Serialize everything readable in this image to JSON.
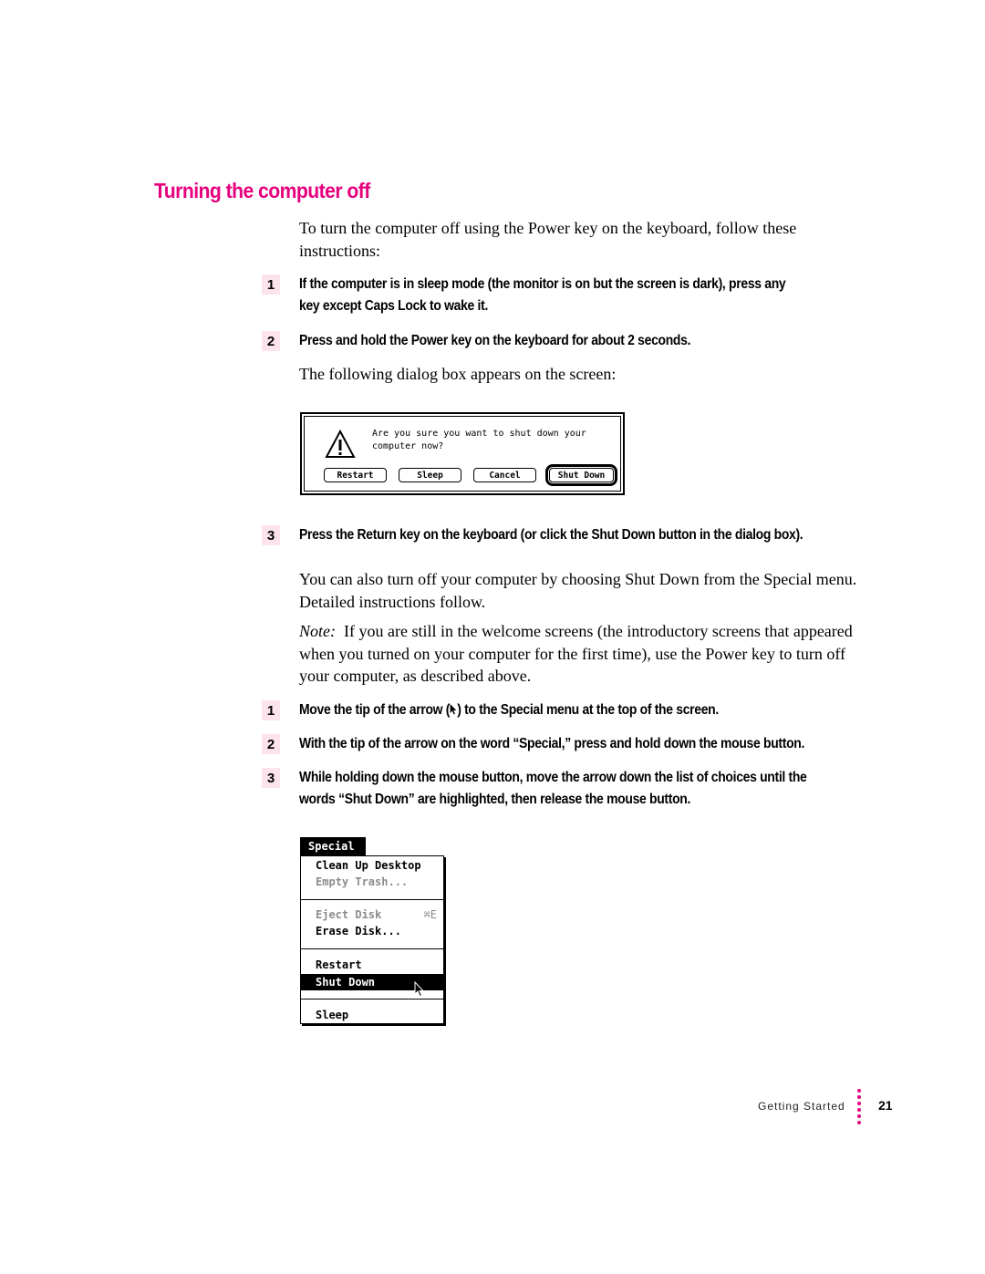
{
  "section": {
    "title": "Turning the computer off",
    "intro": "To turn the computer off using the Power key on the keyboard, follow these instructions:",
    "accent_color": "#e6007e",
    "step_badge_color": "#fde3ec"
  },
  "steps_power_key": [
    {
      "number": "1",
      "text": "If the computer is in sleep mode (the monitor is on but the screen is dark), press any key except Caps Lock to wake it."
    },
    {
      "number": "2",
      "text": "Press and hold the Power key on the keyboard for about 2 seconds."
    }
  ],
  "dialog_intro": "The following dialog box appears on the screen:",
  "dialog": {
    "icon": "caution-icon",
    "message": "Are you sure you want to shut down your computer now?",
    "buttons": [
      {
        "label": "Restart"
      },
      {
        "label": "Sleep"
      },
      {
        "label": "Cancel"
      },
      {
        "label": "Shut Down",
        "default": true
      }
    ]
  },
  "step_return": {
    "number": "3",
    "text": "Press the Return key on the keyboard (or click the Shut Down button in the dialog box)."
  },
  "alt_paragraph": "You can also turn off your computer by choosing Shut Down from the Special menu. Detailed instructions follow.",
  "note": {
    "label": "Note:",
    "text": "If you are still in the welcome screens (the introductory screens that appeared when you turned on your computer for the first time), use the Power key to turn off your computer, as described above."
  },
  "steps_menu": [
    {
      "number": "1",
      "text_before": "Move the tip of the arrow (",
      "icon": "arrow-pointer-icon",
      "text_after": ") to the Special menu at the top of the screen."
    },
    {
      "number": "2",
      "text": "With the tip of the arrow on the word “Special,” press and hold down the mouse button."
    },
    {
      "number": "3",
      "text": "While holding down the mouse button, move the arrow down the list of choices until the words “Shut Down” are highlighted, then release the mouse button."
    }
  ],
  "special_menu": {
    "title": "Special",
    "items": [
      {
        "label": "Clean Up Desktop",
        "state": "enabled"
      },
      {
        "label": "Empty Trash...",
        "state": "disabled"
      },
      {
        "label": "Eject Disk",
        "shortcut": "⌘E",
        "state": "disabled"
      },
      {
        "label": "Erase Disk...",
        "state": "enabled"
      },
      {
        "label": "Restart",
        "state": "enabled"
      },
      {
        "label": "Shut Down",
        "state": "selected"
      },
      {
        "label": "Sleep",
        "state": "enabled"
      }
    ]
  },
  "footer": {
    "section_name": "Getting Started",
    "page_number": "21"
  }
}
